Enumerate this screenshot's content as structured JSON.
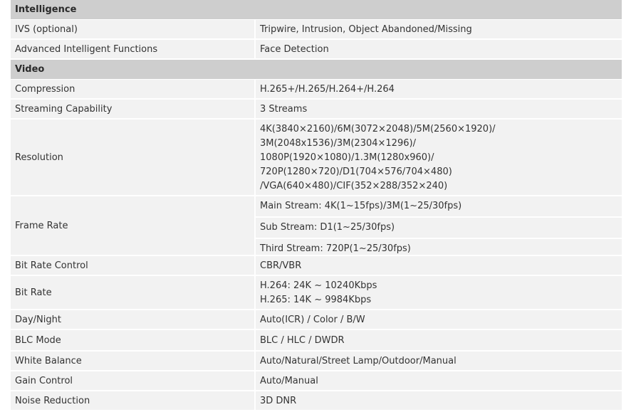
{
  "sections": [
    {
      "title": "Intelligence",
      "rows": [
        {
          "label": "IVS (optional)",
          "values": [
            "Tripwire, Intrusion, Object Abandoned/Missing"
          ]
        },
        {
          "label": "Advanced Intelligent Functions",
          "values": [
            "Face Detection"
          ]
        }
      ]
    },
    {
      "title": "Video",
      "rows": [
        {
          "label": "Compression",
          "values": [
            "H.265+/H.265/H.264+/H.264"
          ]
        },
        {
          "label": "Streaming Capability",
          "values": [
            "3 Streams"
          ]
        },
        {
          "label": "Resolution",
          "values": [
            "4K(3840×2160)/6M(3072×2048)/5M(2560×1920)/",
            "3M(2048x1536)/3M(2304×1296)/",
            "1080P(1920×1080)/1.3M(1280x960)/",
            "720P(1280×720)/D1(704×576/704×480)",
            "/VGA(640×480)/CIF(352×288/352×240)"
          ]
        },
        {
          "label": "Frame Rate",
          "sub": [
            "Main Stream: 4K(1~15fps)/3M(1~25/30fps)",
            "Sub Stream: D1(1~25/30fps)",
            "Third Stream: 720P(1~25/30fps)"
          ]
        },
        {
          "label": "Bit Rate Control",
          "values": [
            "CBR/VBR"
          ]
        },
        {
          "label": "Bit Rate",
          "values": [
            "H.264: 24K ~ 10240Kbps",
            "H.265: 14K ~ 9984Kbps"
          ]
        },
        {
          "label": "Day/Night",
          "values": [
            "Auto(ICR) / Color / B/W"
          ]
        },
        {
          "label": "BLC Mode",
          "values": [
            "BLC / HLC / DWDR"
          ]
        },
        {
          "label": "White Balance",
          "values": [
            "Auto/Natural/Street Lamp/Outdoor/Manual"
          ]
        },
        {
          "label": "Gain Control",
          "values": [
            "Auto/Manual"
          ]
        },
        {
          "label": "Noise Reduction",
          "values": [
            "3D DNR"
          ]
        }
      ]
    }
  ]
}
